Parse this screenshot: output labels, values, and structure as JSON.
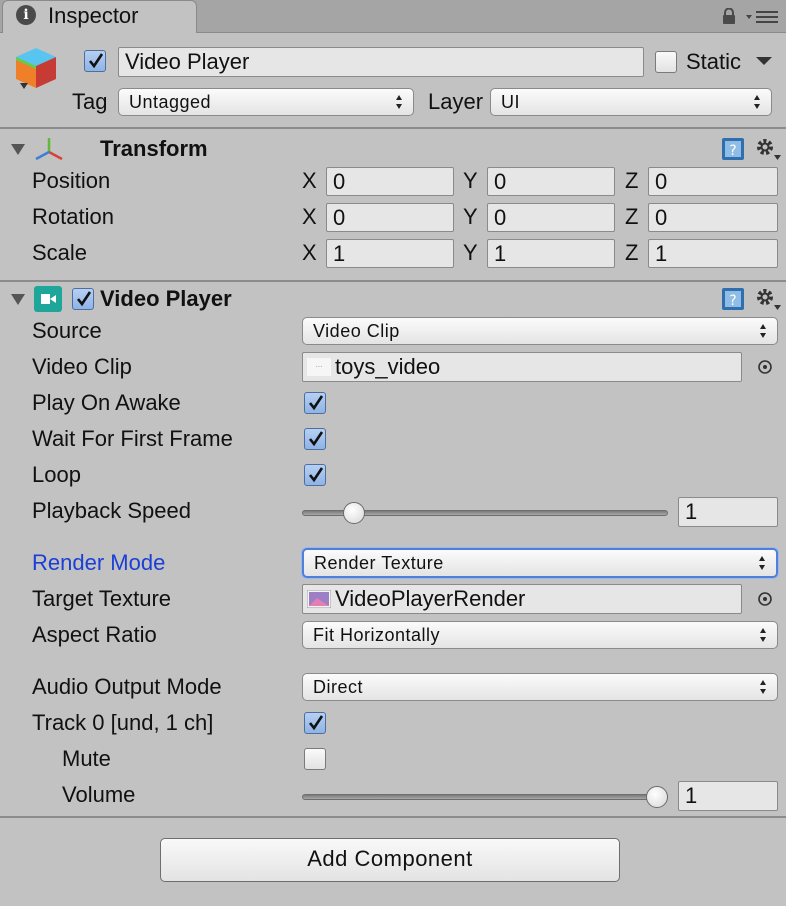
{
  "tab": {
    "label": "Inspector",
    "info_glyph": "i"
  },
  "header": {
    "name": "Video Player",
    "static_label": "Static",
    "tag_label": "Tag",
    "tag_value": "Untagged",
    "layer_label": "Layer",
    "layer_value": "UI"
  },
  "transform": {
    "title": "Transform",
    "rows": [
      {
        "label": "Position",
        "x": "0",
        "y": "0",
        "z": "0"
      },
      {
        "label": "Rotation",
        "x": "0",
        "y": "0",
        "z": "0"
      },
      {
        "label": "Scale",
        "x": "1",
        "y": "1",
        "z": "1"
      }
    ],
    "axis": {
      "x": "X",
      "y": "Y",
      "z": "Z"
    }
  },
  "video_player": {
    "title": "Video Player",
    "source_label": "Source",
    "source_value": "Video Clip",
    "clip_label": "Video Clip",
    "clip_value": "toys_video",
    "play_on_awake_label": "Play On Awake",
    "wait_first_frame_label": "Wait For First Frame",
    "loop_label": "Loop",
    "playback_speed_label": "Playback Speed",
    "playback_speed_value": "1",
    "playback_speed_fraction": 0.12,
    "render_mode_label": "Render Mode",
    "render_mode_value": "Render Texture",
    "target_texture_label": "Target Texture",
    "target_texture_value": "VideoPlayerRender",
    "aspect_ratio_label": "Aspect Ratio",
    "aspect_ratio_value": "Fit Horizontally",
    "audio_output_label": "Audio Output Mode",
    "audio_output_value": "Direct",
    "track_label": "Track 0 [und, 1 ch]",
    "mute_label": "Mute",
    "volume_label": "Volume",
    "volume_value": "1",
    "volume_fraction": 1.0
  },
  "add_component_label": "Add Component",
  "colors": {
    "background": "#c2c2c2",
    "accent_label": "#1b3fd6",
    "focus_ring": "#4f7fd8"
  }
}
